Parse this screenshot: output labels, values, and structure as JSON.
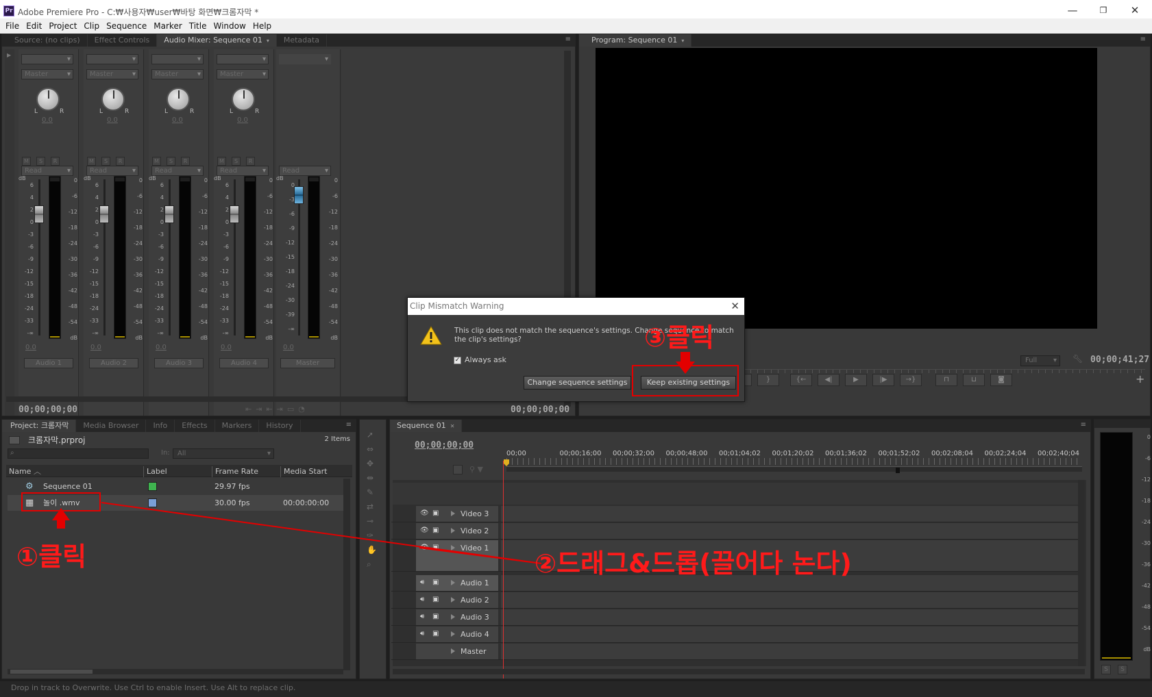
{
  "window": {
    "app_icon": "Pr",
    "title": "Adobe Premiere Pro - C:₩사용자₩user₩바탕 화면₩크롬자막 *",
    "min_icon": "minimize-icon",
    "restore_icon": "restore-icon",
    "close_icon": "close-icon"
  },
  "menu": [
    "File",
    "Edit",
    "Project",
    "Clip",
    "Sequence",
    "Marker",
    "Title",
    "Window",
    "Help"
  ],
  "source_panel": {
    "tabs": [
      "Source: (no clips)",
      "Effect Controls",
      "Audio Mixer: Sequence 01",
      "Metadata"
    ],
    "active_tab": "Audio Mixer: Sequence 01"
  },
  "mixer": {
    "tracks": [
      {
        "name": "Audio 1",
        "send": "Master",
        "auto": "Read",
        "pan": "0.0",
        "vol": "0.0"
      },
      {
        "name": "Audio 2",
        "send": "Master",
        "auto": "Read",
        "pan": "0.0",
        "vol": "0.0"
      },
      {
        "name": "Audio 3",
        "send": "Master",
        "auto": "Read",
        "pan": "0.0",
        "vol": "0.0"
      },
      {
        "name": "Audio 4",
        "send": "Master",
        "auto": "Read",
        "pan": "0.0",
        "vol": "0.0"
      }
    ],
    "master": {
      "name": "Master",
      "auto": "Read",
      "vol": "0.0"
    },
    "msr": [
      "M",
      "S",
      "R"
    ],
    "scale_db": "dB",
    "fader_scale": [
      "6",
      "4",
      "2",
      "0",
      "-3",
      "-6",
      "-9",
      "-12",
      "-15",
      "-18",
      "-24",
      "-33",
      "-∞"
    ],
    "master_scale": [
      "0",
      "-3",
      "-6",
      "-9",
      "-12",
      "-15",
      "-18",
      "-24",
      "-30",
      "-39",
      "-∞"
    ],
    "meter_scale": [
      "0",
      "-6",
      "-12",
      "-18",
      "-24",
      "-30",
      "-36",
      "-42",
      "-48",
      "-54",
      "dB"
    ],
    "timecode_left": "00;00;00;00",
    "timecode_right": "00;00;00;00"
  },
  "program": {
    "tab": "Program: Sequence 01",
    "quality": "Full",
    "timecode": "00;00;41;27"
  },
  "dialog": {
    "title": "Clip Mismatch Warning",
    "message": "This clip does not match the sequence's settings. Change sequence to match the clip's settings?",
    "checkbox_label": "Always ask",
    "checkbox_checked": true,
    "btn_change": "Change sequence settings",
    "btn_keep": "Keep existing settings"
  },
  "project": {
    "tabs": [
      "Project: 크롬자막",
      "Media Browser",
      "Info",
      "Effects",
      "Markers",
      "History"
    ],
    "filename": "크롬자막.prproj",
    "item_count": "2 Items",
    "in_label": "In:",
    "in_value": "All",
    "search_placeholder": "",
    "columns": [
      "Name",
      "Label",
      "Frame Rate",
      "Media Start"
    ],
    "rows": [
      {
        "name": "Sequence 01",
        "label_color": "#3fb34f",
        "frame_rate": "29.97 fps",
        "media_start": ""
      },
      {
        "name": "놀이 .wmv",
        "label_color": "#7a9fd8",
        "frame_rate": "30.00 fps",
        "media_start": "00:00:00:00"
      }
    ]
  },
  "timeline": {
    "tab": "Sequence 01",
    "timecode": "00;00;00;00",
    "ruler": [
      "00;00",
      "00;00;16;00",
      "00;00;32;00",
      "00;00;48;00",
      "00;01;04;02",
      "00;01;20;02",
      "00;01;36;02",
      "00;01;52;02",
      "00;02;08;04",
      "00;02;24;04",
      "00;02;40;04"
    ],
    "video_tracks": [
      "Video 3",
      "Video 2",
      "Video 1"
    ],
    "audio_tracks": [
      "Audio 1",
      "Audio 2",
      "Audio 3",
      "Audio 4"
    ],
    "master_track": "Master"
  },
  "right_meter": {
    "scale": [
      "0",
      "-6",
      "-12",
      "-18",
      "-24",
      "-30",
      "-36",
      "-42",
      "-48",
      "-54",
      "dB"
    ],
    "btns": [
      "S",
      "S"
    ]
  },
  "status_bar": "Drop in track to Overwrite. Use Ctrl to enable Insert. Use Alt to replace clip.",
  "annotations": {
    "step1": "①클릭",
    "step2": "②드래그&드롭(끌어다 논다)",
    "step3": "③클릭",
    "accent": "#ff1a1a"
  }
}
